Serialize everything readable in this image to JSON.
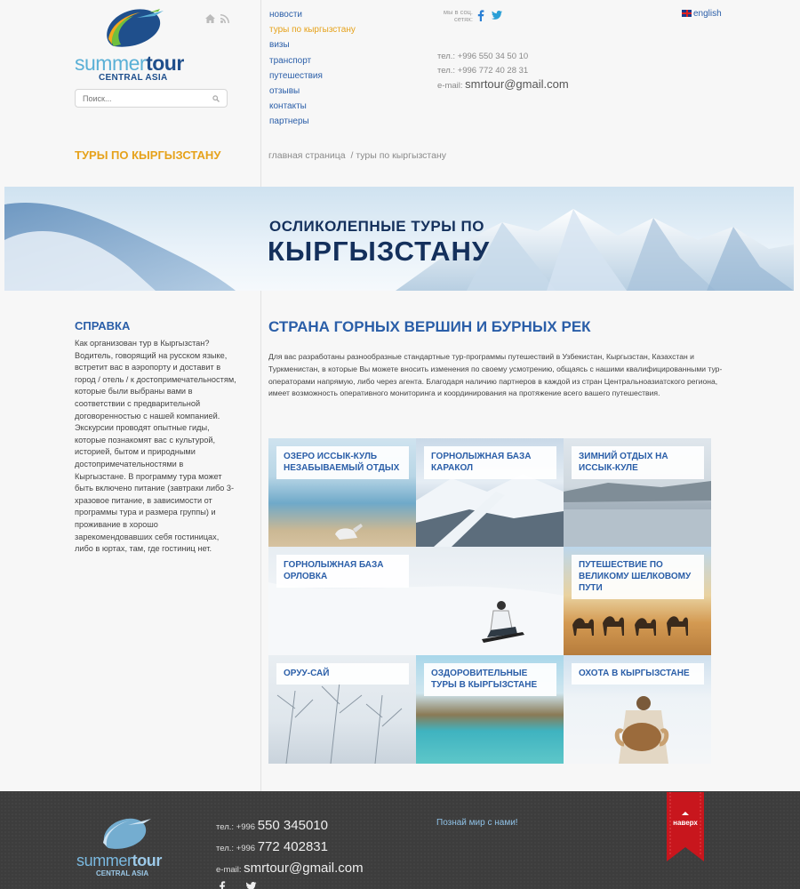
{
  "header": {
    "logo": {
      "word1": "summer",
      "word2": "tour",
      "sub": "CENTRAL ASIA"
    },
    "search_placeholder": "Поиск...",
    "nav": [
      {
        "label": "новости",
        "active": false
      },
      {
        "label": "туры по кыргызстану",
        "active": true
      },
      {
        "label": "визы",
        "active": false
      },
      {
        "label": "транспорт",
        "active": false
      },
      {
        "label": "путешествия",
        "active": false
      },
      {
        "label": "отзывы",
        "active": false
      },
      {
        "label": "контакты",
        "active": false
      },
      {
        "label": "партнеры",
        "active": false
      }
    ],
    "social_label": "мы в соц. сетях:",
    "language": "english",
    "phone1_prefix": "тел.: +996",
    "phone1": "550 34 50 10",
    "phone2_prefix": "тел.: +996",
    "phone2": "772 40 28 31",
    "email_label": "e-mail:",
    "email": "smrtour@gmail.com"
  },
  "page": {
    "section_title": "ТУРЫ ПО КЫРГЫЗСТАНУ",
    "breadcrumb_home": "главная страница",
    "breadcrumb_sep": "/",
    "breadcrumb_current": "туры по кыргызстану"
  },
  "banner": {
    "line1": "ОСЛИКОЛЕПНЫЕ ТУРЫ ПО",
    "line2": "КЫРГЫЗСТАНУ"
  },
  "sidebar": {
    "title": "СПРАВКА",
    "text": "Как организован тур в Кыргызстан? Водитель, говорящий на русском языке, встретит вас в аэропорту и доставит в город / отель / к достопримечательностям, которые были выбраны вами в соответствии с предварительной договоренностью с нашей компанией. Экскурсии проводят опытные гиды, которые познакомят вас с культурой, историей, бытом и природными достопримечательностями в Кыргызстане. В программу тура может быть включено питание (завтраки либо 3-хразовое питание, в зависимости от программы тура и размера группы) и проживание в хорошо зарекомендовавших себя гостиницах, либо в юртах, там, где гостиниц нет."
  },
  "main": {
    "title": "СТРАНА ГОРНЫХ ВЕРШИН И БУРНЫХ РЕК",
    "intro": "Для вас разработаны разнообразные стандартные тур-программы путешествий в Узбекистан, Кыргызстан, Казахстан и Туркменистан, в которые Вы можете вносить изменения по своему усмотрению, общаясь с нашими квалифицированными тур-операторами напрямую, либо через агента. Благодаря наличию партнеров в каждой из стран Центральноазиатского региона, имеет возможность оперативного мониторинга и координирования на протяжение всего вашего путешествия.",
    "tiles": [
      {
        "label": "ОЗЕРО ИССЫК-КУЛЬ НЕЗАБЫВАЕМЫЙ ОТДЫХ",
        "scene": "lake"
      },
      {
        "label": "ГОРНОЛЫЖНАЯ БАЗА КАРАКОЛ",
        "scene": "mountain"
      },
      {
        "label": "ЗИМНИЙ ОТДЫХ НА ИССЫК-КУЛЕ",
        "scene": "winter-lake"
      },
      {
        "label": "ГОРНОЛЫЖНАЯ БАЗА ОРЛОВКА",
        "scene": "snowboard"
      },
      {
        "label": "ПУТЕШЕСТВИЕ ПО ВЕЛИКОМУ ШЕЛКОВОМУ ПУТИ",
        "scene": "camels"
      },
      {
        "label": "ОРУУ-САЙ",
        "scene": "frost-trees"
      },
      {
        "label": "ОЗДОРОВИТЕЛЬНЫЕ ТУРЫ В КЫРГЫЗСТАНЕ",
        "scene": "turquoise-lake"
      },
      {
        "label": "ОХОТА В КЫРГЫЗСТАНЕ",
        "scene": "hunter"
      }
    ]
  },
  "footer": {
    "logo": {
      "word1": "summer",
      "word2": "tour",
      "sub": "CENTRAL ASIA"
    },
    "phone1_prefix": "тел.: +996",
    "phone1": "550 345010",
    "phone2_prefix": "тел.: +996",
    "phone2": "772 402831",
    "email_label": "e-mail:",
    "email": "smrtour@gmail.com",
    "slogan": "Познай мир с нами!",
    "top_button": "наверх"
  },
  "colors": {
    "link": "#2a5ea8",
    "accent": "#e6a21b",
    "footer_bg": "#3d3d3d",
    "ribbon": "#c8161d"
  }
}
